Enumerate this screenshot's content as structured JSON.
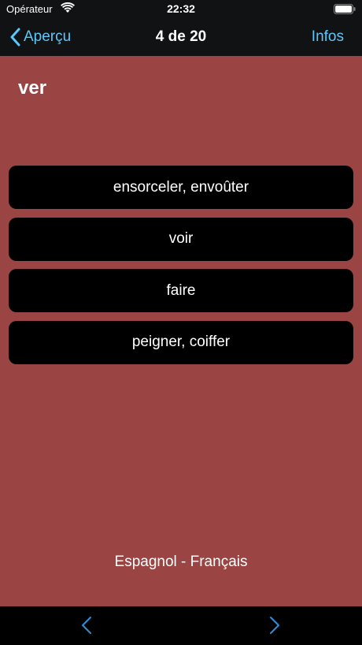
{
  "status_bar": {
    "carrier": "Opérateur",
    "time": "22:32",
    "wifi_icon": "wifi-icon",
    "battery_icon": "battery-icon"
  },
  "nav": {
    "back_label": "Aperçu",
    "title": "4 de 20",
    "info_label": "Infos"
  },
  "quiz": {
    "word": "ver",
    "choices": [
      "ensorceler, envoûter",
      "voir",
      "faire",
      "peigner, coiffer"
    ],
    "language_pair": "Espagnol - Français"
  },
  "toolbar": {
    "prev_icon": "chevron-left-icon",
    "next_icon": "chevron-right-icon"
  },
  "colors": {
    "background": "#9a4544",
    "accent": "#5ac8fa",
    "choice_bg": "#000000"
  }
}
